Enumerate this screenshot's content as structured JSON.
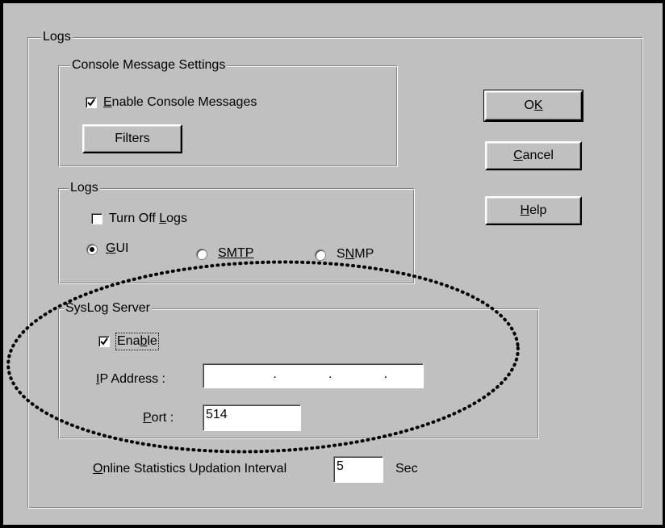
{
  "outer_group": {
    "title": "Logs"
  },
  "console_group": {
    "title": "Console Message Settings",
    "enable_checkbox": {
      "label_pre": "",
      "label_mnemonic": "E",
      "label_post": "nable Console Messages",
      "checked": true
    },
    "filters_button": "Filters"
  },
  "logs_group": {
    "title": "Logs",
    "turn_off_checkbox": {
      "label_pre": "Turn Off ",
      "label_mnemonic": "L",
      "label_post": "ogs",
      "checked": false
    },
    "radios": [
      {
        "label_pre": "",
        "label_mnemonic": "G",
        "label_post": "UI",
        "selected": true
      },
      {
        "label_pre": "",
        "label_mnemonic": "",
        "label_post": "SMTP",
        "selected": false
      },
      {
        "label_pre": "S",
        "label_mnemonic": "N",
        "label_post": "MP",
        "selected": false
      }
    ]
  },
  "syslog_group": {
    "title": "SysLog Server",
    "enable_checkbox": {
      "label_pre": "Ena",
      "label_mnemonic": "b",
      "label_post": "le",
      "checked": true
    },
    "ip_label_mnemonic": "I",
    "ip_label_rest": "P Address :",
    "ip_value": "   .     .     .   ",
    "port_label_mnemonic": "P",
    "port_label_rest": "ort :",
    "port_value": "514"
  },
  "interval": {
    "label_mnemonic": "O",
    "label_rest": "nline Statistics Updation Interval",
    "value": "5",
    "unit": "Sec"
  },
  "buttons": {
    "ok_pre": "O",
    "ok_mnemonic": "K",
    "cancel_mnemonic": "C",
    "cancel_rest": "ancel",
    "help_mnemonic": "H",
    "help_rest": "elp"
  },
  "annotation": {
    "shape": "dotted-ellipse",
    "color": "#000000",
    "highlights": "syslog_group"
  }
}
